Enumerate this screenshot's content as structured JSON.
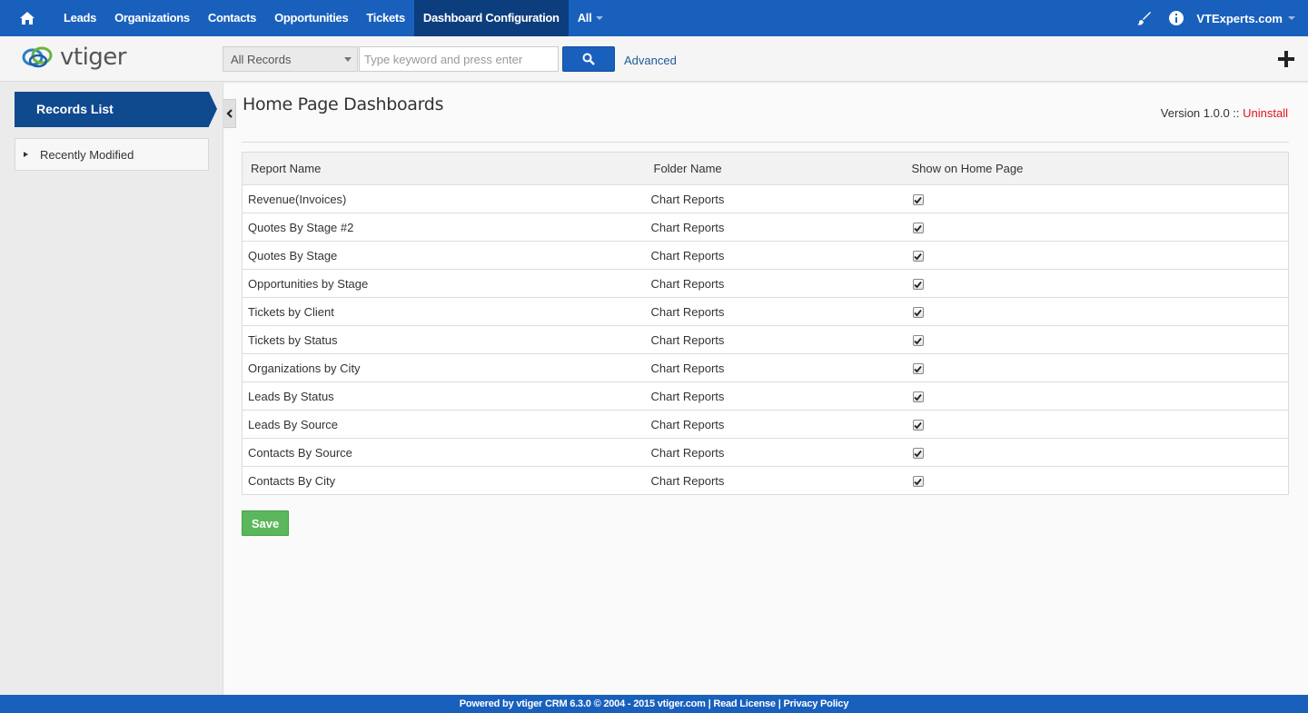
{
  "nav": {
    "items": [
      {
        "label": "Leads",
        "active": false
      },
      {
        "label": "Organizations",
        "active": false
      },
      {
        "label": "Contacts",
        "active": false
      },
      {
        "label": "Opportunities",
        "active": false
      },
      {
        "label": "Tickets",
        "active": false
      },
      {
        "label": "Dashboard Configuration",
        "active": true
      }
    ],
    "all_label": "All",
    "user_label": "VTExperts.com",
    "icons": [
      "home-icon",
      "paintbrush-icon",
      "info-icon",
      "chevron-down-icon"
    ]
  },
  "logo": {
    "text": "vtiger"
  },
  "search": {
    "filter_value": "All Records",
    "placeholder": "Type keyword and press enter",
    "advanced_label": "Advanced"
  },
  "sidebar": {
    "header": "Records List",
    "items": [
      {
        "label": "Recently Modified"
      }
    ]
  },
  "main": {
    "title": "Home Page Dashboards",
    "version_text": "Version 1.0.0 :: ",
    "uninstall_label": "Uninstall",
    "table": {
      "headers": [
        "Report Name",
        "Folder Name",
        "Show on Home Page"
      ],
      "rows": [
        {
          "report": "Revenue(Invoices)",
          "folder": "Chart Reports",
          "show": true
        },
        {
          "report": "Quotes By Stage #2",
          "folder": "Chart Reports",
          "show": true
        },
        {
          "report": "Quotes By Stage",
          "folder": "Chart Reports",
          "show": true
        },
        {
          "report": "Opportunities by Stage",
          "folder": "Chart Reports",
          "show": true
        },
        {
          "report": "Tickets by Client",
          "folder": "Chart Reports",
          "show": true
        },
        {
          "report": "Tickets by Status",
          "folder": "Chart Reports",
          "show": true
        },
        {
          "report": "Organizations by City",
          "folder": "Chart Reports",
          "show": true
        },
        {
          "report": "Leads By Status",
          "folder": "Chart Reports",
          "show": true
        },
        {
          "report": "Leads By Source",
          "folder": "Chart Reports",
          "show": true
        },
        {
          "report": "Contacts By Source",
          "folder": "Chart Reports",
          "show": true
        },
        {
          "report": "Contacts By City",
          "folder": "Chart Reports",
          "show": true
        }
      ]
    },
    "save_label": "Save"
  },
  "footer": {
    "text": "Powered by vtiger CRM 6.3.0  © 2004 - 2015  vtiger.com | Read License | Privacy Policy"
  },
  "colors": {
    "nav_blue": "#1960bd",
    "nav_active": "#0c3d7d",
    "sidebar_header": "#0f4a8f",
    "save_green": "#5bb75b",
    "uninstall_red": "#e0141e"
  }
}
